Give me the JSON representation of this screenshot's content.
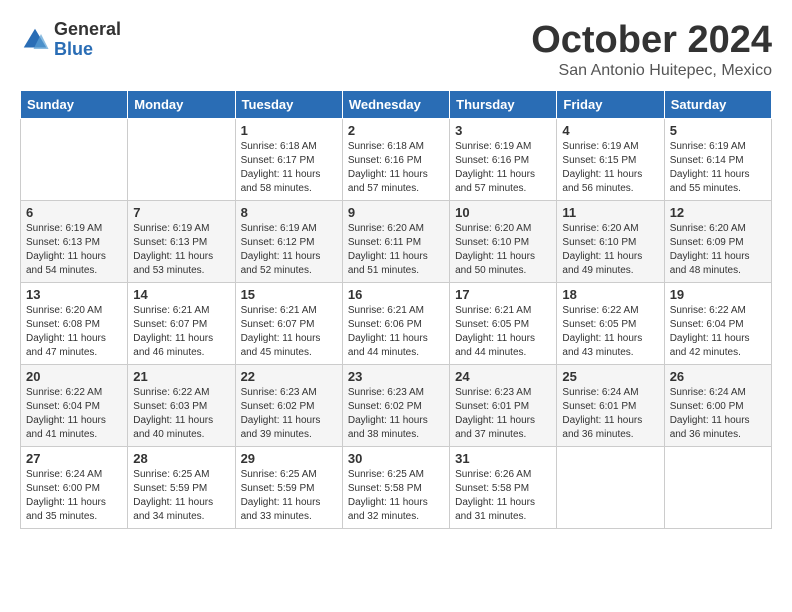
{
  "logo": {
    "general": "General",
    "blue": "Blue"
  },
  "title": "October 2024",
  "subtitle": "San Antonio Huitepec, Mexico",
  "days_of_week": [
    "Sunday",
    "Monday",
    "Tuesday",
    "Wednesday",
    "Thursday",
    "Friday",
    "Saturday"
  ],
  "weeks": [
    [
      {
        "day": "",
        "info": ""
      },
      {
        "day": "",
        "info": ""
      },
      {
        "day": "1",
        "info": "Sunrise: 6:18 AM\nSunset: 6:17 PM\nDaylight: 11 hours and 58 minutes."
      },
      {
        "day": "2",
        "info": "Sunrise: 6:18 AM\nSunset: 6:16 PM\nDaylight: 11 hours and 57 minutes."
      },
      {
        "day": "3",
        "info": "Sunrise: 6:19 AM\nSunset: 6:16 PM\nDaylight: 11 hours and 57 minutes."
      },
      {
        "day": "4",
        "info": "Sunrise: 6:19 AM\nSunset: 6:15 PM\nDaylight: 11 hours and 56 minutes."
      },
      {
        "day": "5",
        "info": "Sunrise: 6:19 AM\nSunset: 6:14 PM\nDaylight: 11 hours and 55 minutes."
      }
    ],
    [
      {
        "day": "6",
        "info": "Sunrise: 6:19 AM\nSunset: 6:13 PM\nDaylight: 11 hours and 54 minutes."
      },
      {
        "day": "7",
        "info": "Sunrise: 6:19 AM\nSunset: 6:13 PM\nDaylight: 11 hours and 53 minutes."
      },
      {
        "day": "8",
        "info": "Sunrise: 6:19 AM\nSunset: 6:12 PM\nDaylight: 11 hours and 52 minutes."
      },
      {
        "day": "9",
        "info": "Sunrise: 6:20 AM\nSunset: 6:11 PM\nDaylight: 11 hours and 51 minutes."
      },
      {
        "day": "10",
        "info": "Sunrise: 6:20 AM\nSunset: 6:10 PM\nDaylight: 11 hours and 50 minutes."
      },
      {
        "day": "11",
        "info": "Sunrise: 6:20 AM\nSunset: 6:10 PM\nDaylight: 11 hours and 49 minutes."
      },
      {
        "day": "12",
        "info": "Sunrise: 6:20 AM\nSunset: 6:09 PM\nDaylight: 11 hours and 48 minutes."
      }
    ],
    [
      {
        "day": "13",
        "info": "Sunrise: 6:20 AM\nSunset: 6:08 PM\nDaylight: 11 hours and 47 minutes."
      },
      {
        "day": "14",
        "info": "Sunrise: 6:21 AM\nSunset: 6:07 PM\nDaylight: 11 hours and 46 minutes."
      },
      {
        "day": "15",
        "info": "Sunrise: 6:21 AM\nSunset: 6:07 PM\nDaylight: 11 hours and 45 minutes."
      },
      {
        "day": "16",
        "info": "Sunrise: 6:21 AM\nSunset: 6:06 PM\nDaylight: 11 hours and 44 minutes."
      },
      {
        "day": "17",
        "info": "Sunrise: 6:21 AM\nSunset: 6:05 PM\nDaylight: 11 hours and 44 minutes."
      },
      {
        "day": "18",
        "info": "Sunrise: 6:22 AM\nSunset: 6:05 PM\nDaylight: 11 hours and 43 minutes."
      },
      {
        "day": "19",
        "info": "Sunrise: 6:22 AM\nSunset: 6:04 PM\nDaylight: 11 hours and 42 minutes."
      }
    ],
    [
      {
        "day": "20",
        "info": "Sunrise: 6:22 AM\nSunset: 6:04 PM\nDaylight: 11 hours and 41 minutes."
      },
      {
        "day": "21",
        "info": "Sunrise: 6:22 AM\nSunset: 6:03 PM\nDaylight: 11 hours and 40 minutes."
      },
      {
        "day": "22",
        "info": "Sunrise: 6:23 AM\nSunset: 6:02 PM\nDaylight: 11 hours and 39 minutes."
      },
      {
        "day": "23",
        "info": "Sunrise: 6:23 AM\nSunset: 6:02 PM\nDaylight: 11 hours and 38 minutes."
      },
      {
        "day": "24",
        "info": "Sunrise: 6:23 AM\nSunset: 6:01 PM\nDaylight: 11 hours and 37 minutes."
      },
      {
        "day": "25",
        "info": "Sunrise: 6:24 AM\nSunset: 6:01 PM\nDaylight: 11 hours and 36 minutes."
      },
      {
        "day": "26",
        "info": "Sunrise: 6:24 AM\nSunset: 6:00 PM\nDaylight: 11 hours and 36 minutes."
      }
    ],
    [
      {
        "day": "27",
        "info": "Sunrise: 6:24 AM\nSunset: 6:00 PM\nDaylight: 11 hours and 35 minutes."
      },
      {
        "day": "28",
        "info": "Sunrise: 6:25 AM\nSunset: 5:59 PM\nDaylight: 11 hours and 34 minutes."
      },
      {
        "day": "29",
        "info": "Sunrise: 6:25 AM\nSunset: 5:59 PM\nDaylight: 11 hours and 33 minutes."
      },
      {
        "day": "30",
        "info": "Sunrise: 6:25 AM\nSunset: 5:58 PM\nDaylight: 11 hours and 32 minutes."
      },
      {
        "day": "31",
        "info": "Sunrise: 6:26 AM\nSunset: 5:58 PM\nDaylight: 11 hours and 31 minutes."
      },
      {
        "day": "",
        "info": ""
      },
      {
        "day": "",
        "info": ""
      }
    ]
  ]
}
